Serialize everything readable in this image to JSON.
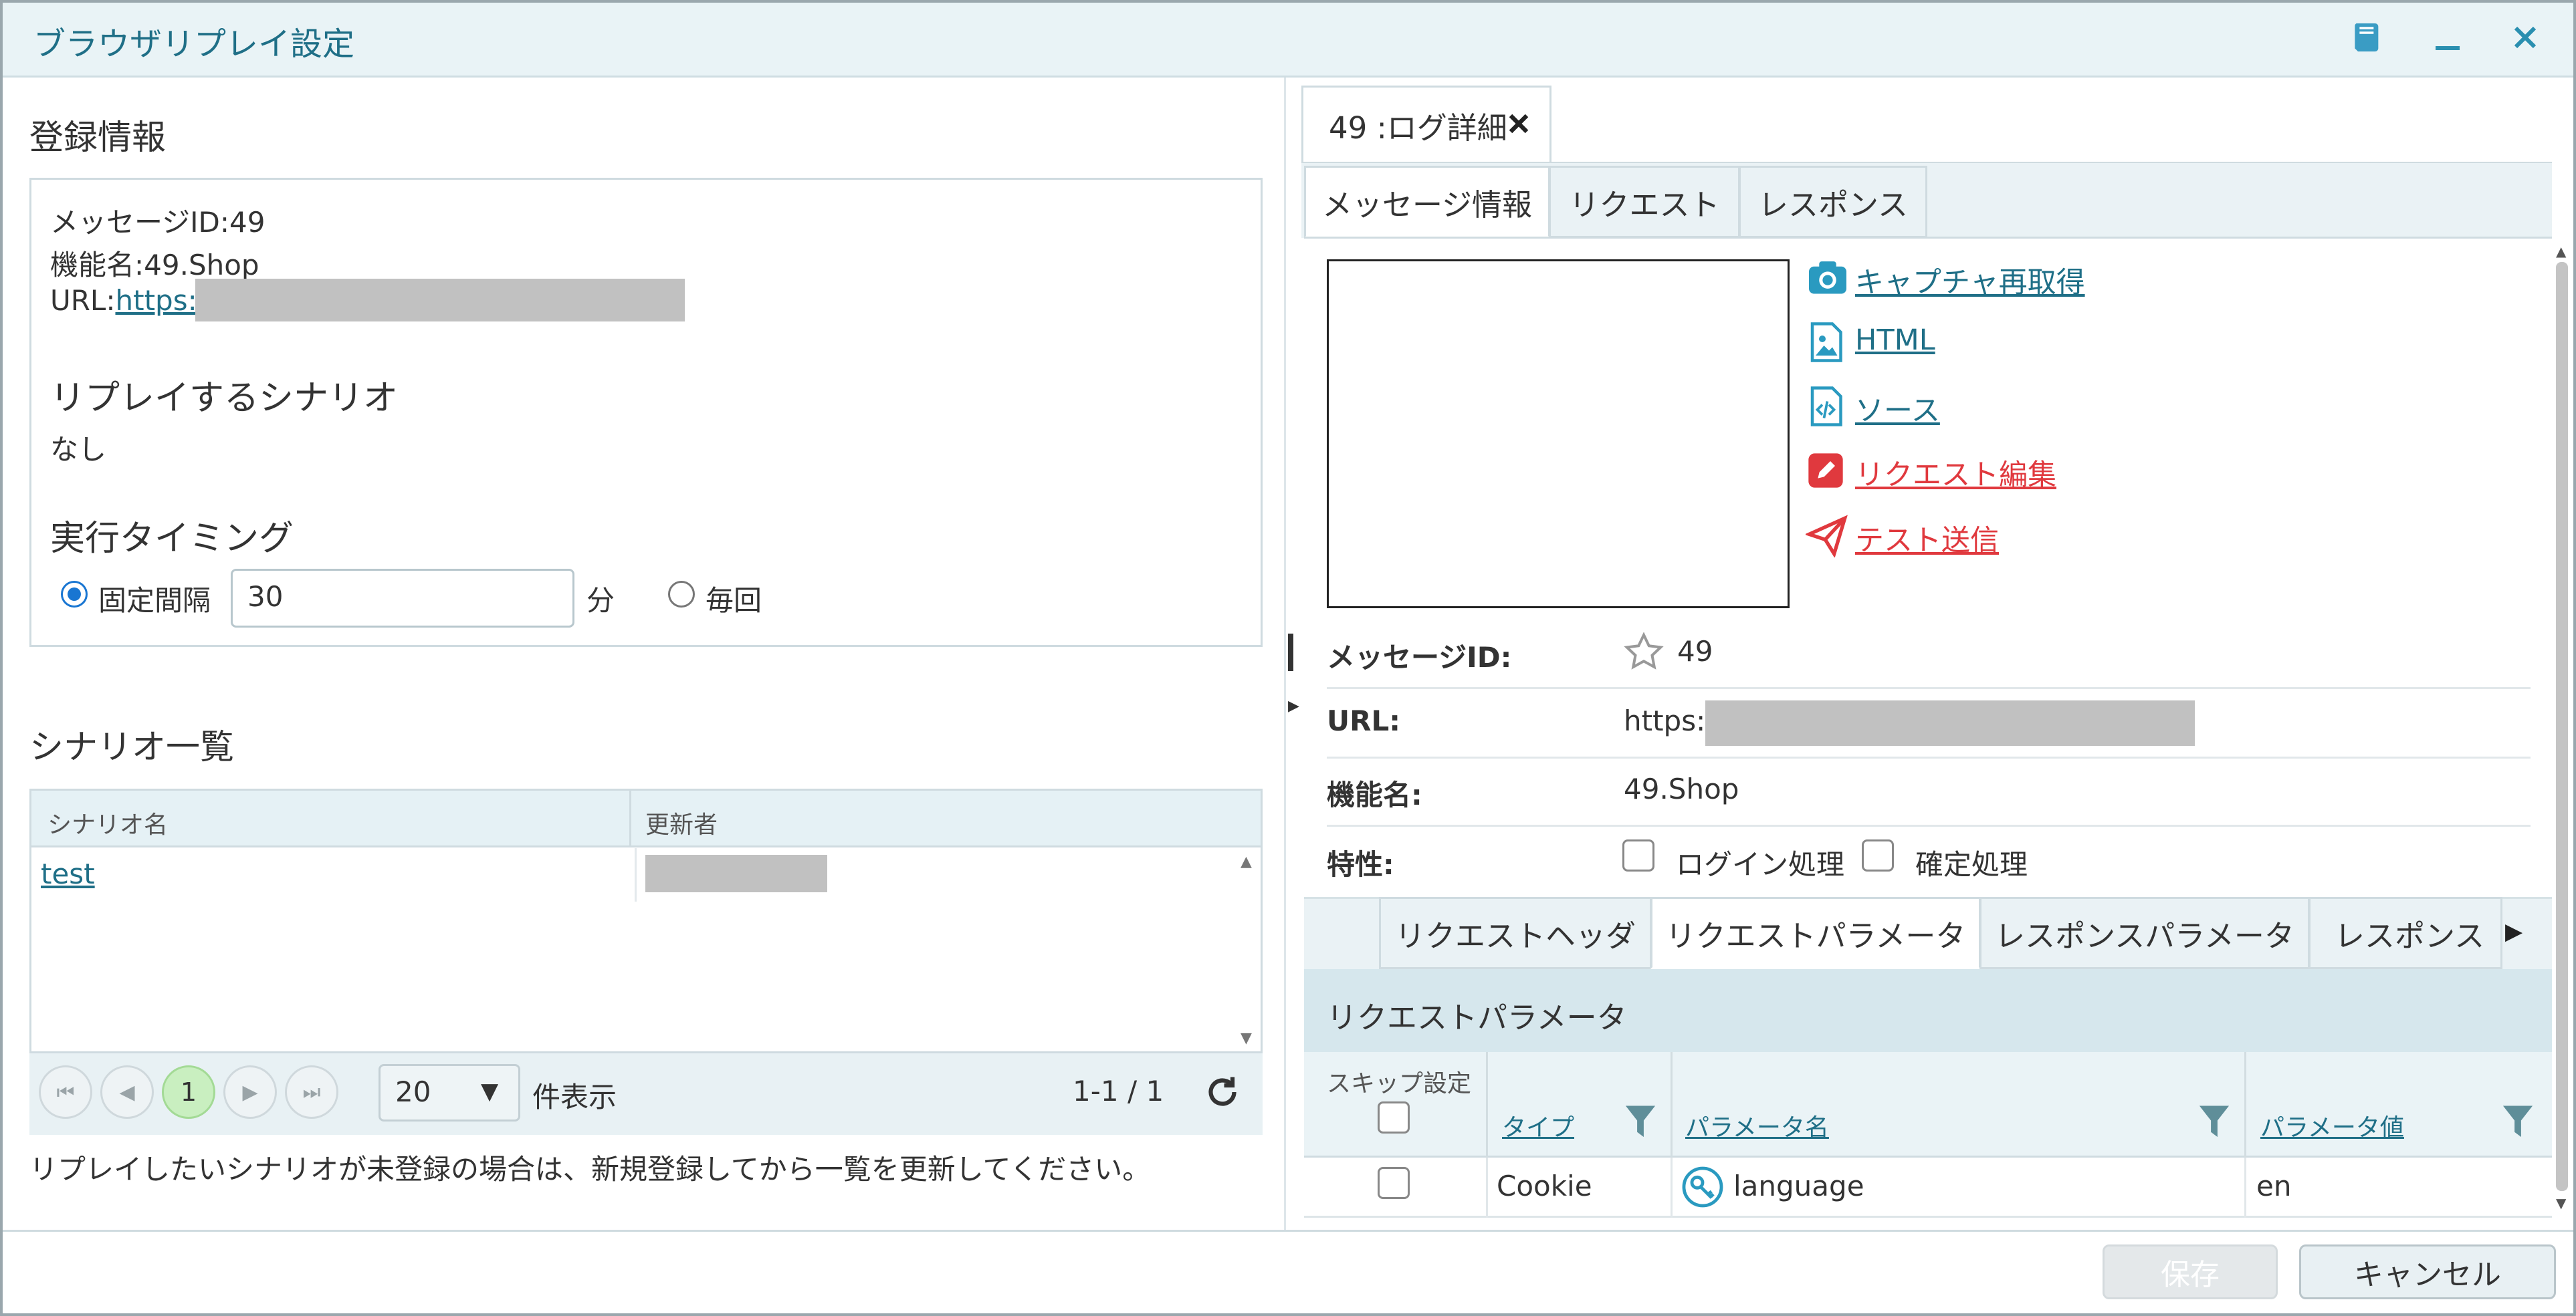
{
  "window": {
    "title": "ブラウザリプレイ設定"
  },
  "left": {
    "reg_title": "登録情報",
    "message_id": "メッセージID:49",
    "func_name": "機能名:49.Shop",
    "url_label": "URL:",
    "url_link": "https:",
    "scenario_title": "リプレイするシナリオ",
    "scenario_value": "なし",
    "timing_title": "実行タイミング",
    "fixed_label": "固定間隔",
    "interval_value": "30",
    "minute_unit": "分",
    "every_label": "毎回",
    "list_title": "シナリオ一覧",
    "col_name": "シナリオ名",
    "col_updater": "更新者",
    "rows": [
      {
        "name": "test"
      }
    ],
    "page_current": "1",
    "page_size": "20",
    "page_size_unit": "件表示",
    "range": "1-1 / 1",
    "hint": "リプレイしたいシナリオが未登録の場合は、新規登録してから一覧を更新してください。"
  },
  "right": {
    "doc_tab": "49 :ログ詳細",
    "tabs": [
      "メッセージ情報",
      "リクエスト",
      "レスポンス"
    ],
    "actions": {
      "recapture": "キャプチャ再取得",
      "html": "HTML",
      "source": "ソース",
      "edit_request": "リクエスト編集",
      "test_send": "テスト送信"
    },
    "fields": {
      "message_id_label": "メッセージID:",
      "message_id_value": "49",
      "url_label": "URL:",
      "url_value": "https:",
      "func_label": "機能名:",
      "func_value": "49.Shop",
      "attr_label": "特性:",
      "login_label": "ログイン処理",
      "confirm_label": "確定処理"
    },
    "subtabs": [
      "リクエストヘッダ",
      "リクエストパラメータ",
      "レスポンスパラメータ",
      "レスポンス"
    ],
    "params_title": "リクエストパラメータ",
    "param_cols": {
      "skip": "スキップ設定",
      "type": "タイプ",
      "name": "パラメータ名",
      "value": "パラメータ値"
    },
    "param_rows": [
      {
        "type": "Cookie",
        "name": "language",
        "value": "en"
      }
    ]
  },
  "footer": {
    "save": "保存",
    "cancel": "キャンセル"
  },
  "colors": {
    "accent": "#1f6f87",
    "danger": "#e0393e",
    "icon_blue": "#2a9ac0"
  }
}
